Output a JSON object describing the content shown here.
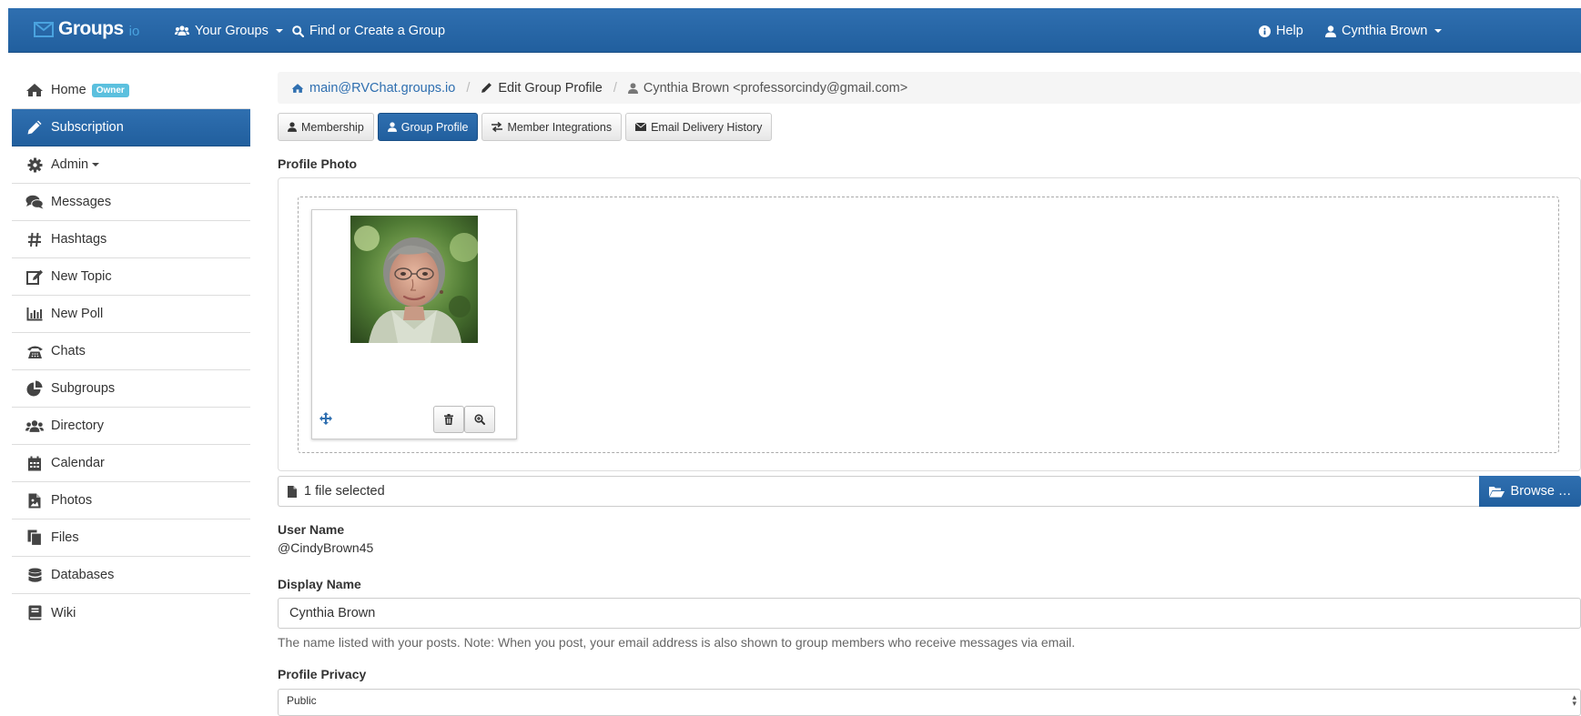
{
  "navbar": {
    "brand": "Groups",
    "brand_suffix": "io",
    "your_groups": "Your Groups",
    "find_create": "Find or Create a Group",
    "help": "Help",
    "user": "Cynthia Brown"
  },
  "sidebar": {
    "items": [
      {
        "label": "Home",
        "icon": "home-icon",
        "badge": "Owner"
      },
      {
        "label": "Subscription",
        "icon": "pencil-icon",
        "active": true
      },
      {
        "label": "Admin",
        "icon": "gear-icon",
        "dropdown": true
      },
      {
        "label": "Messages",
        "icon": "comments-icon"
      },
      {
        "label": "Hashtags",
        "icon": "hashtag-icon"
      },
      {
        "label": "New Topic",
        "icon": "edit-icon"
      },
      {
        "label": "New Poll",
        "icon": "bar-chart-icon"
      },
      {
        "label": "Chats",
        "icon": "phone-icon"
      },
      {
        "label": "Subgroups",
        "icon": "pie-chart-icon"
      },
      {
        "label": "Directory",
        "icon": "users-icon"
      },
      {
        "label": "Calendar",
        "icon": "calendar-icon"
      },
      {
        "label": "Photos",
        "icon": "photo-file-icon"
      },
      {
        "label": "Files",
        "icon": "files-icon"
      },
      {
        "label": "Databases",
        "icon": "database-icon"
      },
      {
        "label": "Wiki",
        "icon": "book-icon"
      }
    ]
  },
  "breadcrumb": {
    "group": "main@RVChat.groups.io",
    "page": "Edit Group Profile",
    "member": "Cynthia Brown <professorcindy@gmail.com>"
  },
  "tabs": [
    {
      "label": "Membership",
      "icon": "user-icon"
    },
    {
      "label": "Group Profile",
      "icon": "user-icon",
      "active": true
    },
    {
      "label": "Member Integrations",
      "icon": "exchange-icon"
    },
    {
      "label": "Email Delivery History",
      "icon": "envelope-icon"
    }
  ],
  "profile_photo": {
    "label": "Profile Photo",
    "file_status": "1 file selected",
    "browse_label": "Browse …"
  },
  "user_name": {
    "label": "User Name",
    "value": "@CindyBrown45"
  },
  "display_name": {
    "label": "Display Name",
    "value": "Cynthia Brown",
    "help": "The name listed with your posts. Note: When you post, your email address is also shown to group members who receive messages via email."
  },
  "profile_privacy": {
    "label": "Profile Privacy",
    "value": "Public"
  },
  "colors": {
    "primary": "#2f6fb0",
    "badge": "#5bc0de"
  }
}
